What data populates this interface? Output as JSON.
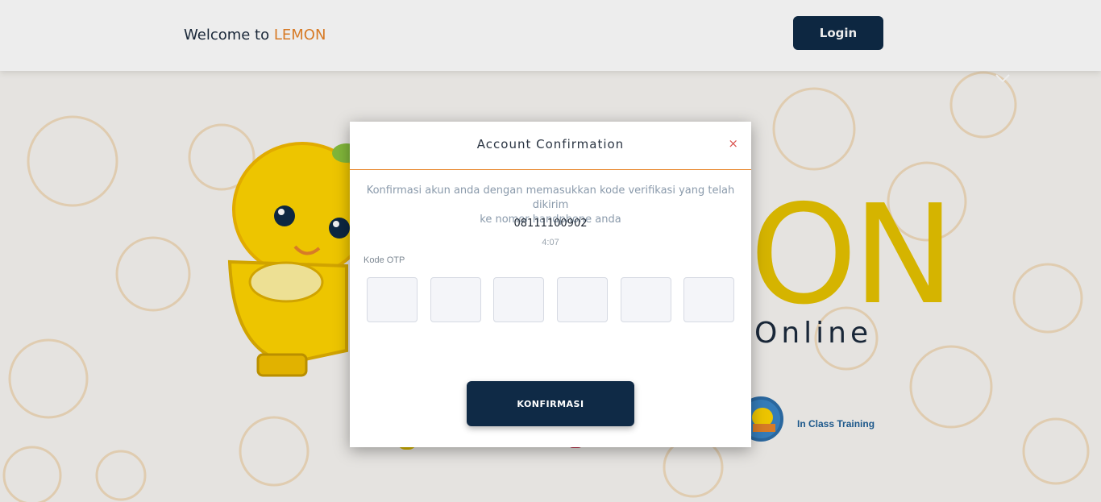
{
  "header": {
    "brand_prefix": "Welcome to",
    "brand_name": "LEMON",
    "login_label": "Login"
  },
  "background": {
    "hero_letters": "ON",
    "hero_subtitle": "Online",
    "feature_label": "In Class Training"
  },
  "modal": {
    "title": "Account Confirmation",
    "close_label": "×",
    "description_line1": "Konfirmasi akun anda dengan memasukkan kode verifikasi yang telah dikirim",
    "description_line2": "ke nomor handphone anda",
    "phone_number": "08111100902",
    "timer": "4:07",
    "otp_label": "Kode OTP",
    "otp_values": [
      "",
      "",
      "",
      "",
      "",
      ""
    ],
    "confirm_label": "KONFIRMASI"
  },
  "colors": {
    "accent": "#e8852a",
    "primary": "#0f2a46",
    "hero_yellow": "#e6c200"
  }
}
